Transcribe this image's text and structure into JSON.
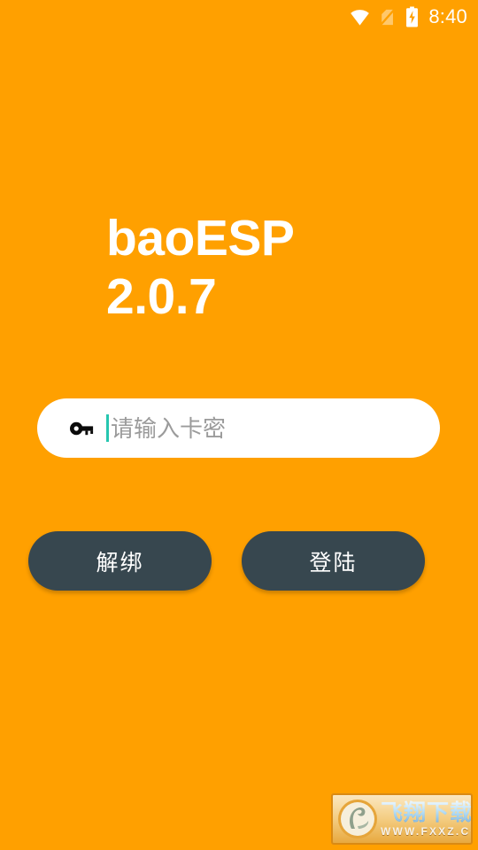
{
  "theme": {
    "background_color": "#FFA000",
    "button_color": "#37474F",
    "input_background": "#FFFFFF",
    "caret_color": "#26C6B0",
    "placeholder_color": "#9B9B9B",
    "text_color": "#FFFFFF"
  },
  "status_bar": {
    "wifi_icon": "wifi-icon",
    "sim_icon": "no-sim-card-icon",
    "battery_icon": "battery-charging-icon",
    "time": "8:40"
  },
  "header": {
    "app_name": "baoESP",
    "version": "2.0.7"
  },
  "card_key_field": {
    "icon": "key-icon",
    "value": "",
    "placeholder": "请输入卡密",
    "focused": true
  },
  "actions": {
    "unbind_label": "解绑",
    "login_label": "登陆"
  },
  "watermark": {
    "logo_icon": "fxxz-bird-logo-icon",
    "site_name": "飞翔下载",
    "site_url": "WWW.FXXZ.COM"
  }
}
